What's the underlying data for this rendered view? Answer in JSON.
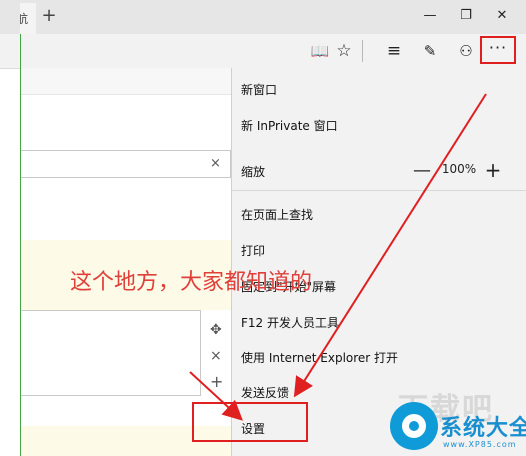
{
  "tab": {
    "title_fragment": "航",
    "new_tab_glyph": "+"
  },
  "window": {
    "minimize": "—",
    "restore": "❐",
    "close": "✕"
  },
  "toolbar": {
    "reading_view": "📖",
    "favorite": "☆",
    "hub": "≡",
    "web_note": "✎",
    "share": "⚇",
    "more": "···"
  },
  "page": {
    "clear_glyph": "×",
    "move_glyph": "✥",
    "close_glyph": "×",
    "add_glyph": "+"
  },
  "menu": {
    "new_window": "新窗口",
    "new_inprivate": "新 InPrivate 窗口",
    "zoom_label": "缩放",
    "zoom_minus": "—",
    "zoom_value": "100%",
    "zoom_plus": "+",
    "find_on_page": "在页面上查找",
    "print": "打印",
    "pin_to_start": "固定到\"开始\"屏幕",
    "dev_tools": "F12 开发人员工具",
    "open_with_ie": "使用 Internet Explorer 打开",
    "send_feedback": "发送反馈",
    "settings": "设置"
  },
  "annotation": {
    "text": "这个地方，大家都知道的",
    "color": "#e0403a"
  },
  "watermark": {
    "bg_text": "下载吧",
    "brand": "系统大全",
    "url": "www.XP85.com"
  },
  "colors": {
    "highlight_red": "#e02020",
    "watermark_blue": "#1a8fd0"
  }
}
